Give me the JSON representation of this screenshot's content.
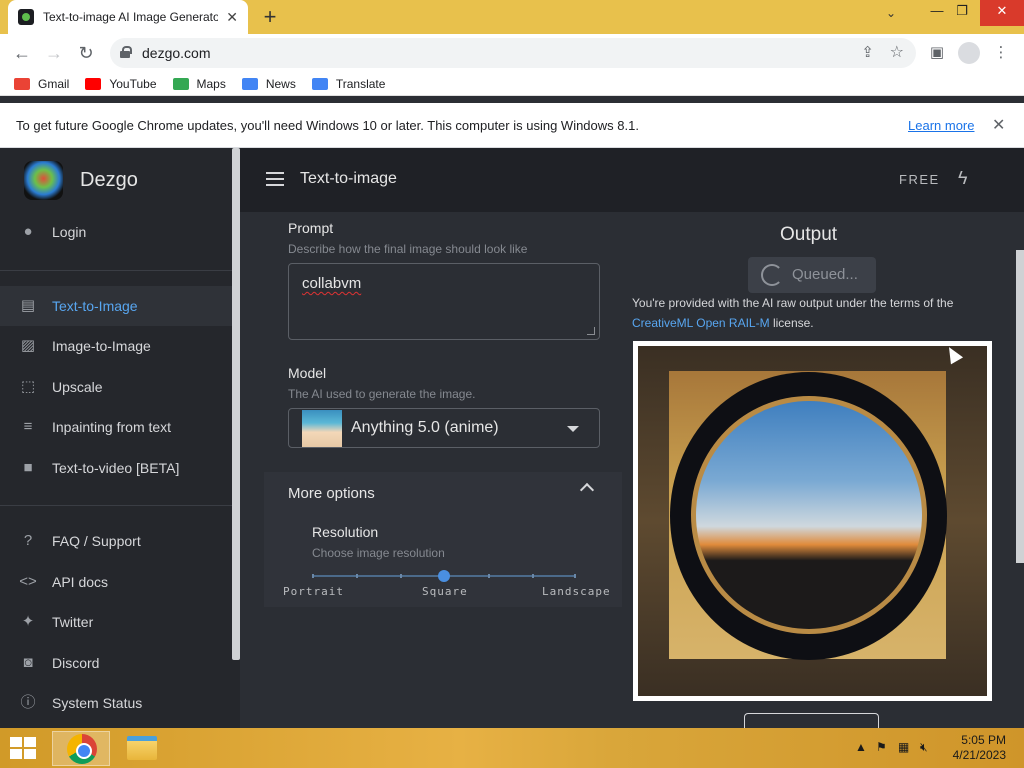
{
  "browser": {
    "tab_title": "Text-to-image AI Image Generator",
    "url": "dezgo.com",
    "bookmarks": [
      {
        "label": "Gmail",
        "color": "#ea4335"
      },
      {
        "label": "YouTube",
        "color": "#ff0000"
      },
      {
        "label": "Maps",
        "color": "#34a853"
      },
      {
        "label": "News",
        "color": "#4285f4"
      },
      {
        "label": "Translate",
        "color": "#4285f4"
      }
    ],
    "infobar": {
      "message": "To get future Google Chrome updates, you'll need Windows 10 or later. This computer is using Windows 8.1.",
      "link": "Learn more"
    }
  },
  "app": {
    "brand": "Dezgo",
    "header_title": "Text-to-image",
    "plan": "FREE",
    "sidebar": {
      "login": "Login",
      "tools": [
        {
          "label": "Text-to-Image",
          "icon": "chat-icon",
          "active": true
        },
        {
          "label": "Image-to-Image",
          "icon": "image-icon",
          "active": false
        },
        {
          "label": "Upscale",
          "icon": "upscale-icon",
          "active": false
        },
        {
          "label": "Inpainting from text",
          "icon": "inpaint-icon",
          "active": false
        },
        {
          "label": "Text-to-video [BETA]",
          "icon": "video-icon",
          "active": false
        }
      ],
      "links": [
        {
          "label": "FAQ / Support",
          "icon": "help-icon"
        },
        {
          "label": "API docs",
          "icon": "code-icon"
        },
        {
          "label": "Twitter",
          "icon": "twitter-icon"
        },
        {
          "label": "Discord",
          "icon": "discord-icon"
        },
        {
          "label": "System Status",
          "icon": "info-icon"
        }
      ]
    },
    "form": {
      "prompt_label": "Prompt",
      "prompt_hint": "Describe how the final image should look like",
      "prompt_value": "collabvm",
      "model_label": "Model",
      "model_hint": "The AI used to generate the image.",
      "model_value": "Anything 5.0 (anime)",
      "more_options": "More options",
      "resolution_label": "Resolution",
      "resolution_hint": "Choose image resolution",
      "resolution_options": [
        "Portrait",
        "Square",
        "Landscape"
      ],
      "resolution_selected": "Square"
    },
    "output": {
      "title": "Output",
      "status": "Queued...",
      "terms_pre": "You're provided with the AI raw output under the terms of the",
      "terms_link": "CreativeML Open RAIL-M",
      "terms_post": "license."
    }
  },
  "taskbar": {
    "time": "5:05 PM",
    "date": "4/21/2023"
  }
}
